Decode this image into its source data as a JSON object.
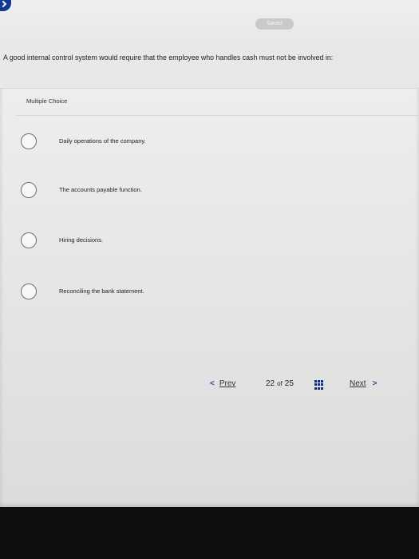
{
  "header": {
    "saved_label": "Saved"
  },
  "question": {
    "text": "A good internal control system would require that the employee who handles cash must not be involved in:"
  },
  "section": {
    "label": "Multiple Choice"
  },
  "options": [
    {
      "label": "Daily operations of the company."
    },
    {
      "label": "The accounts payable function."
    },
    {
      "label": "Hiring decisions."
    },
    {
      "label": "Reconciling the bank statement."
    }
  ],
  "navigation": {
    "prev_label": "Prev",
    "current_page": "22",
    "of_label": "of",
    "total_pages": "25",
    "next_label": "Next"
  },
  "icons": {
    "back": "back-icon",
    "grid": "grid-icon",
    "prev": "chevron-left-icon",
    "next": "chevron-right-icon"
  },
  "colors": {
    "accent": "#1b4da0",
    "back_icon": "#123a8f"
  }
}
